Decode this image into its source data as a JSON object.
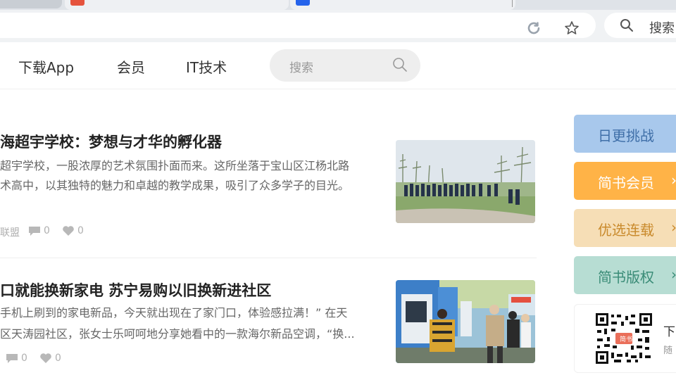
{
  "browser": {
    "search_label": "搜索",
    "icons": [
      "refresh-icon",
      "star-icon",
      "search-icon"
    ]
  },
  "header": {
    "nav": [
      "下载App",
      "会员",
      "IT技术"
    ],
    "search_placeholder": "搜索"
  },
  "articles": [
    {
      "title": "海超宇学校：梦想与才华的孵化器",
      "abstract_lines": [
        "超宇学校，一股浓厚的艺术氛围扑面而来。这所坐落于宝山区江杨北路",
        "术高中，以其独特的魅力和卓越的教学成果，吸引了众多学子的目光。"
      ],
      "meta_source": "联盟",
      "comments": "0",
      "likes": "0"
    },
    {
      "title": "口就能换新家电 苏宁易购以旧换新进社区",
      "abstract_lines": [
        "手机上刷到的家电新品，今天就出现在了家门口，体验感拉满！” 在天",
        "区天涛园社区，张女士乐呵呵地分享她看中的一款海尔新品空调，“换..."
      ],
      "comments": "0",
      "likes": "0"
    }
  ],
  "sidebar": {
    "buttons": [
      {
        "label": "日更挑战",
        "color": "#a8c8ec",
        "text_color": "#3f6fa8"
      },
      {
        "label": "简书会员",
        "color": "#ffb347",
        "text_color": "#ffffff"
      },
      {
        "label": "优选连载",
        "color": "#f6deb6",
        "text_color": "#c98a2c"
      },
      {
        "label": "简书版权",
        "color": "#b7ddd3",
        "text_color": "#3a8c77"
      }
    ],
    "download": {
      "title": "下",
      "subtitle": "随",
      "qr_badge": "简书"
    }
  },
  "colors": {
    "accent": "#ea6f5a",
    "chrome": "#f0f2f4"
  }
}
